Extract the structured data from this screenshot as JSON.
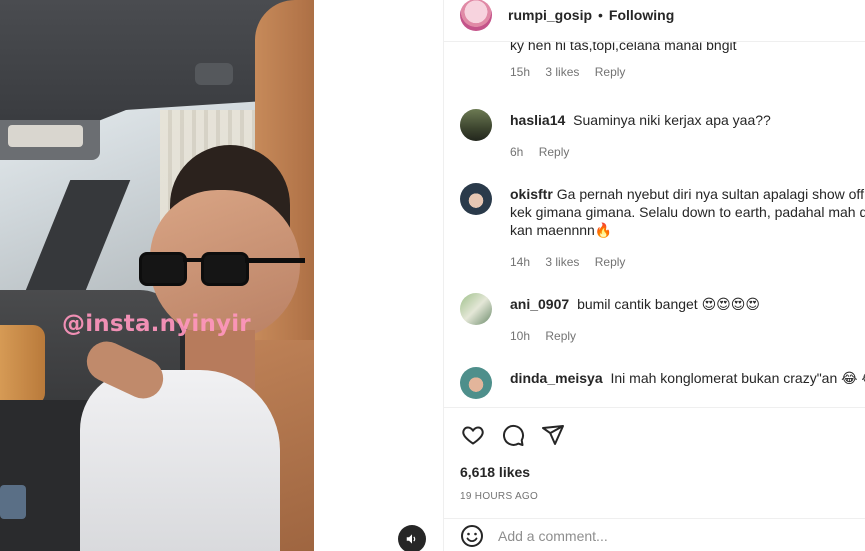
{
  "post": {
    "username": "rumpi_gosip",
    "separator": "•",
    "follow_status": "Following",
    "watermark": "@insta.nyinyir",
    "likes": "6,618 likes",
    "posted_ago": "19 HOURS AGO",
    "add_comment_placeholder": "Add a comment..."
  },
  "comments": [
    {
      "username": "",
      "text": "ky  hen hi tas,topi,celana manai bngit",
      "time": "15h",
      "likes": "3 likes",
      "reply": "Reply"
    },
    {
      "username": "haslia14",
      "text": "Suaminya niki kerjax apa yaa??",
      "time": "6h",
      "likes": "",
      "reply": "Reply"
    },
    {
      "username": "okisftr",
      "text_line1": "Ga pernah nyebut diri nya sultan apalagi show off y",
      "text_line2": "kek gimana gimana. Selalu down to earth, padahal mah du",
      "text_line3": "kan maennnn🔥",
      "time": "14h",
      "likes": "3 likes",
      "reply": "Reply"
    },
    {
      "username": "ani_0907",
      "text": "bumil cantik banget 😍😍😍😍",
      "time": "10h",
      "likes": "",
      "reply": "Reply"
    },
    {
      "username": "dinda_meisya",
      "text": "Ini mah konglomerat bukan crazy\"an 😂 😂"
    }
  ],
  "icons": {
    "like": "heart-icon",
    "comment": "comment-icon",
    "share": "share-icon",
    "emoji": "emoji-icon",
    "audio": "speaker-icon"
  }
}
